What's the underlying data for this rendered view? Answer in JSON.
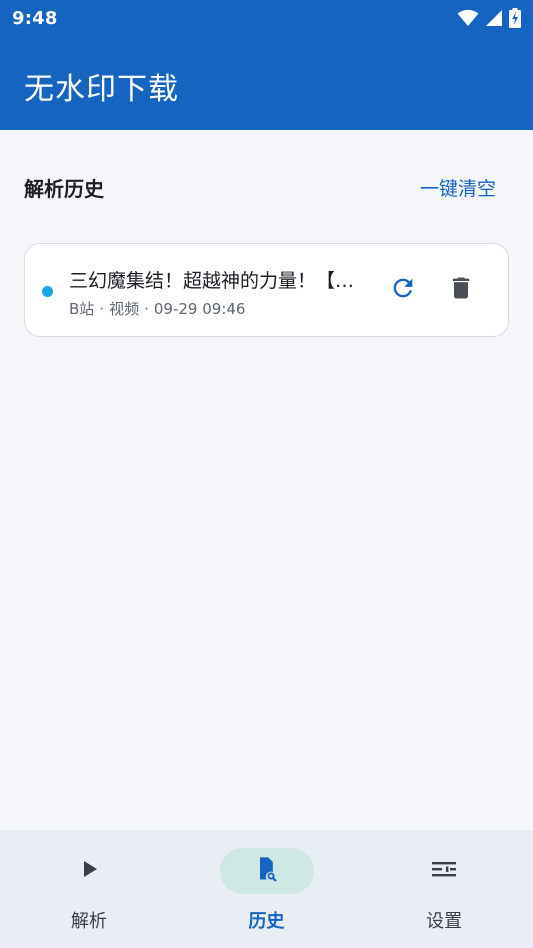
{
  "status_bar": {
    "time": "9:48",
    "icons": [
      "wifi-icon",
      "signal-icon",
      "battery-charging-icon"
    ]
  },
  "app_bar": {
    "title": "无水印下载",
    "color": "#1565c0"
  },
  "history_section": {
    "title": "解析历史",
    "clear_all_label": "一键清空"
  },
  "history_items": [
    {
      "title": "三幻魔集结！超越神的力量！【…",
      "source": "B站",
      "type": "视频",
      "time": "09-29 09:46",
      "status_color": "#1aa7e8",
      "actions": [
        "refresh-icon",
        "delete-icon"
      ]
    }
  ],
  "bottom_nav": {
    "items": [
      {
        "label": "解析",
        "icon": "play-icon",
        "active": false
      },
      {
        "label": "历史",
        "icon": "history-search-icon",
        "active": true
      },
      {
        "label": "设置",
        "icon": "tune-icon",
        "active": false
      }
    ],
    "active_color": "#1565c0"
  }
}
